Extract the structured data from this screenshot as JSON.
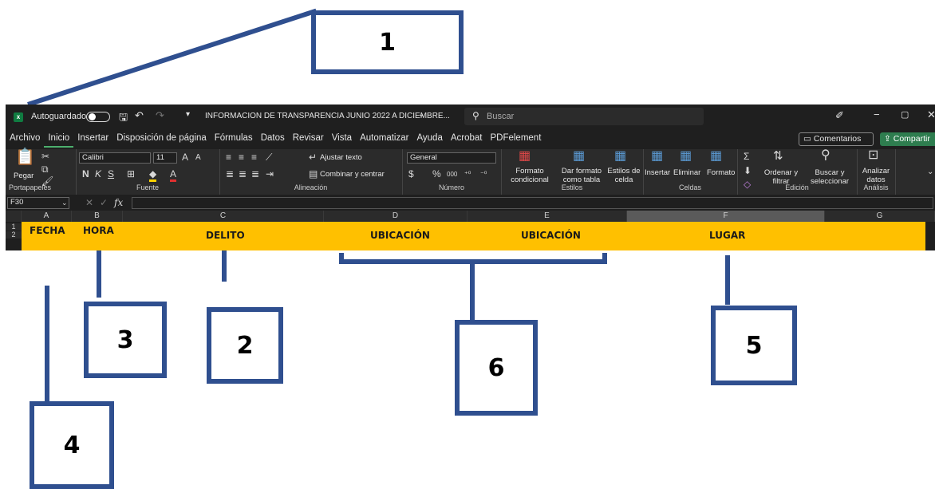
{
  "annotations": [
    "1",
    "2",
    "3",
    "4",
    "5",
    "6"
  ],
  "titlebar": {
    "app_icon": "excel-icon",
    "autosave_label": "Autoguardado",
    "file_title": "INFORMACION DE TRANSPARENCIA JUNIO 2022 A DICIEMBRE...",
    "search_placeholder": "Buscar"
  },
  "tabs": [
    "Archivo",
    "Inicio",
    "Insertar",
    "Disposición de página",
    "Fórmulas",
    "Datos",
    "Revisar",
    "Vista",
    "Automatizar",
    "Ayuda",
    "Acrobat",
    "PDFelement"
  ],
  "actions": {
    "comments": "Comentarios",
    "share": "Compartir"
  },
  "ribbon": {
    "clipboard": {
      "paste": "Pegar",
      "group": "Portapapeles"
    },
    "font": {
      "name": "Calibri",
      "size": "11",
      "group": "Fuente",
      "bold": "N",
      "italic": "K",
      "underline": "S"
    },
    "alignment": {
      "wrap": "Ajustar texto",
      "merge": "Combinar y centrar",
      "group": "Alineación"
    },
    "number": {
      "format": "General",
      "currency": "$",
      "percent": "%",
      "thousands": "000",
      "group": "Número"
    },
    "styles": {
      "conditional1": "Formato",
      "conditional2": "condicional",
      "table1": "Dar formato",
      "table2": "como tabla",
      "cell1": "Estilos de",
      "cell2": "celda",
      "group": "Estilos"
    },
    "cells": {
      "insert": "Insertar",
      "delete": "Eliminar",
      "format": "Formato",
      "group": "Celdas"
    },
    "editing": {
      "sort1": "Ordenar y",
      "sort2": "filtrar",
      "find1": "Buscar y",
      "find2": "seleccionar",
      "group": "Edición"
    },
    "analysis": {
      "analyze1": "Analizar",
      "analyze2": "datos",
      "group": "Análisis"
    }
  },
  "formula_bar": {
    "cell_ref": "F30",
    "fx": "fx"
  },
  "columns": [
    "A",
    "B",
    "C",
    "D",
    "E",
    "F",
    "G"
  ],
  "rows": [
    "1",
    "2"
  ],
  "headers": {
    "fecha": "FECHA",
    "hora": "HORA",
    "delito": "DELITO",
    "ubicacion_d": "UBICACIÓN",
    "ubicacion_e": "UBICACIÓN",
    "lugar": "LUGAR"
  },
  "colors": {
    "header_fill": "#ffc000",
    "annotation": "#2f4f8f",
    "excel_green": "#107c41"
  }
}
